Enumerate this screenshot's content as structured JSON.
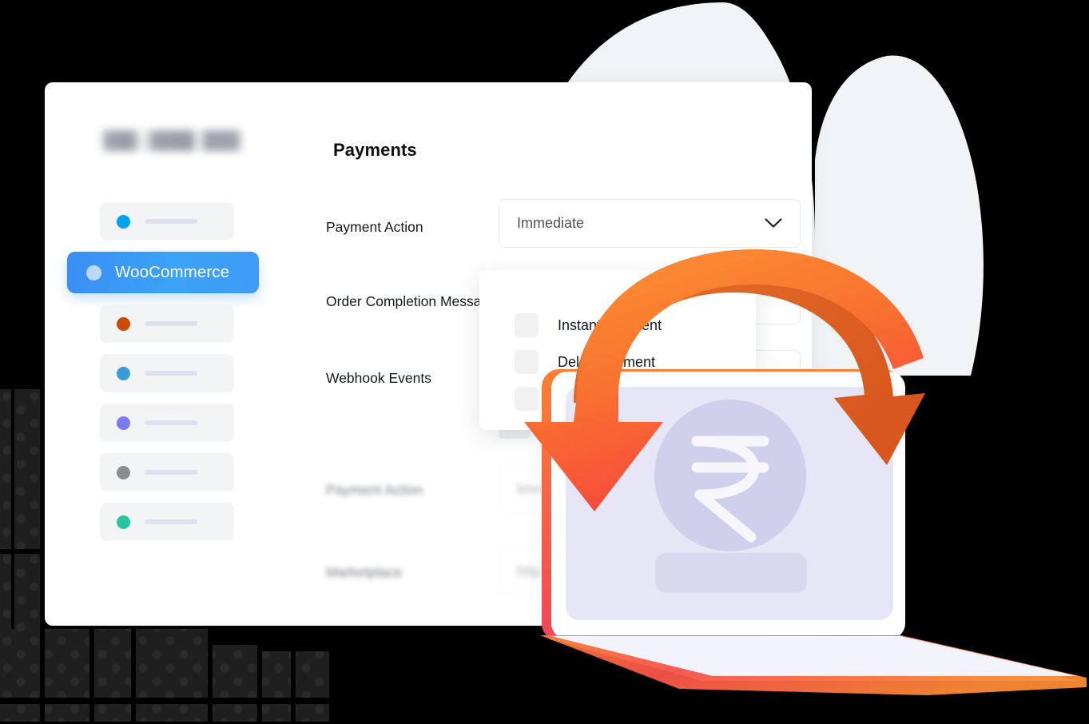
{
  "window": {
    "title_blurred": true
  },
  "sidebar": {
    "brand_placeholder": "",
    "items": [
      {
        "label": "",
        "dot_color": "#00a3ee",
        "active": false,
        "name": "sidebar-item-1"
      },
      {
        "label": "WooCommerce",
        "dot_color": "#bcd9fb",
        "active": true,
        "name": "sidebar-item-woocommerce"
      },
      {
        "label": "",
        "dot_color": "#cc4a04",
        "active": false,
        "name": "sidebar-item-3"
      },
      {
        "label": "",
        "dot_color": "#3d9bd6",
        "active": false,
        "name": "sidebar-item-4"
      },
      {
        "label": "",
        "dot_color": "#7b7bf5",
        "active": false,
        "name": "sidebar-item-5"
      },
      {
        "label": "",
        "dot_color": "#8c8c8c",
        "active": false,
        "name": "sidebar-item-6"
      },
      {
        "label": "",
        "dot_color": "#2bc4a0",
        "active": false,
        "name": "sidebar-item-7"
      }
    ]
  },
  "main": {
    "page_title": "Payments",
    "fields": [
      {
        "label": "Payment Action",
        "value": "Immediate",
        "type": "select"
      },
      {
        "label": "Order Completion Message",
        "value": "",
        "type": "text"
      },
      {
        "label": "Webhook Events",
        "value": "",
        "type": "text"
      }
    ],
    "blurred_fields": [
      {
        "label": "Payment Action",
        "value": "Immediate"
      },
      {
        "label": "Marketplace",
        "value": "http:wpex.l"
      }
    ]
  },
  "dropdown": {
    "options": [
      {
        "label": "Instant Payment",
        "checked": false
      },
      {
        "label": "Delay Payment",
        "checked": false
      },
      {
        "label": "",
        "checked": false
      }
    ]
  },
  "illustration": {
    "currency_symbol": "₹",
    "arrow_gradient_start": "#f97316",
    "arrow_gradient_end": "#f43f3f",
    "laptop_screen_color": "#e7e6f7",
    "blob_color": "#f1f4f7"
  }
}
